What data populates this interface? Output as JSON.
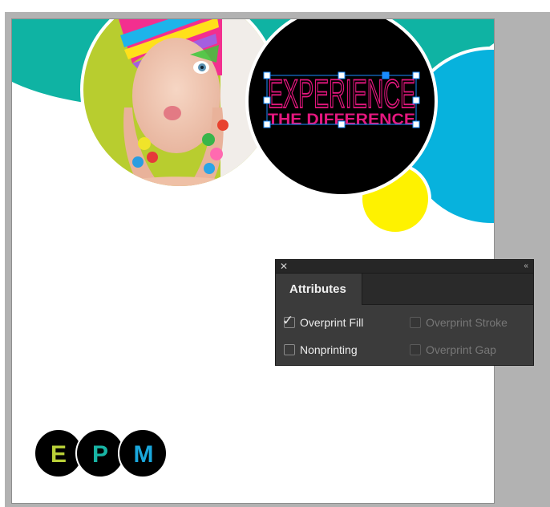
{
  "canvas": {
    "headline": "EXPERIENCE",
    "subheadline": "THE DIFFERENCE",
    "logo_letters": [
      "E",
      "P",
      "M"
    ],
    "colors": {
      "teal": "#0fb3a3",
      "cyan": "#07b2dd",
      "yellow": "#fef200",
      "lime": "#b8cd2f",
      "magenta": "#e5177f",
      "black": "#000000",
      "logo_e": "#b9d038",
      "logo_p": "#18b4a4",
      "logo_m": "#1aa7dc",
      "selection": "#1a8cff"
    }
  },
  "attributes_panel": {
    "close_glyph": "✕",
    "collapse_glyph": "‹‹",
    "tab_label": "Attributes",
    "options": {
      "overprint_fill": {
        "label": "Overprint Fill",
        "checked": true,
        "enabled": true
      },
      "overprint_stroke": {
        "label": "Overprint Stroke",
        "checked": false,
        "enabled": false
      },
      "nonprinting": {
        "label": "Nonprinting",
        "checked": false,
        "enabled": true
      },
      "overprint_gap": {
        "label": "Overprint Gap",
        "checked": false,
        "enabled": false
      }
    }
  }
}
